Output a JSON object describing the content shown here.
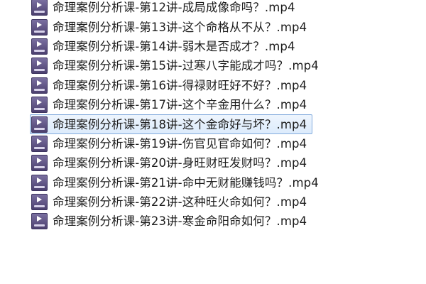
{
  "file_list": {
    "icon": "mp4-video-file-icon",
    "selected_index": 6,
    "files": [
      "命理案例分析课-第12讲-成局成像命吗？.mp4",
      "命理案例分析课-第13讲-这个命格从不从？.mp4",
      "命理案例分析课-第14讲-弱木是否成才？.mp4",
      "命理案例分析课-第15讲-过寒八字能成才吗？.mp4",
      "命理案例分析课-第16讲-得禄财旺好不好？.mp4",
      "命理案例分析课-第17讲-这个辛金用什么？.mp4",
      "命理案例分析课-第18讲-这个金命好与坏？.mp4",
      "命理案例分析课-第19讲-伤官见官命如何？.mp4",
      "命理案例分析课-第20讲-身旺财旺发财吗？.mp4",
      "命理案例分析课-第21讲-命中无财能赚钱吗？.mp4",
      "命理案例分析课-第22讲-这种旺火命如何？.mp4",
      "命理案例分析课-第23讲-寒金命阳命如何？.mp4"
    ]
  }
}
